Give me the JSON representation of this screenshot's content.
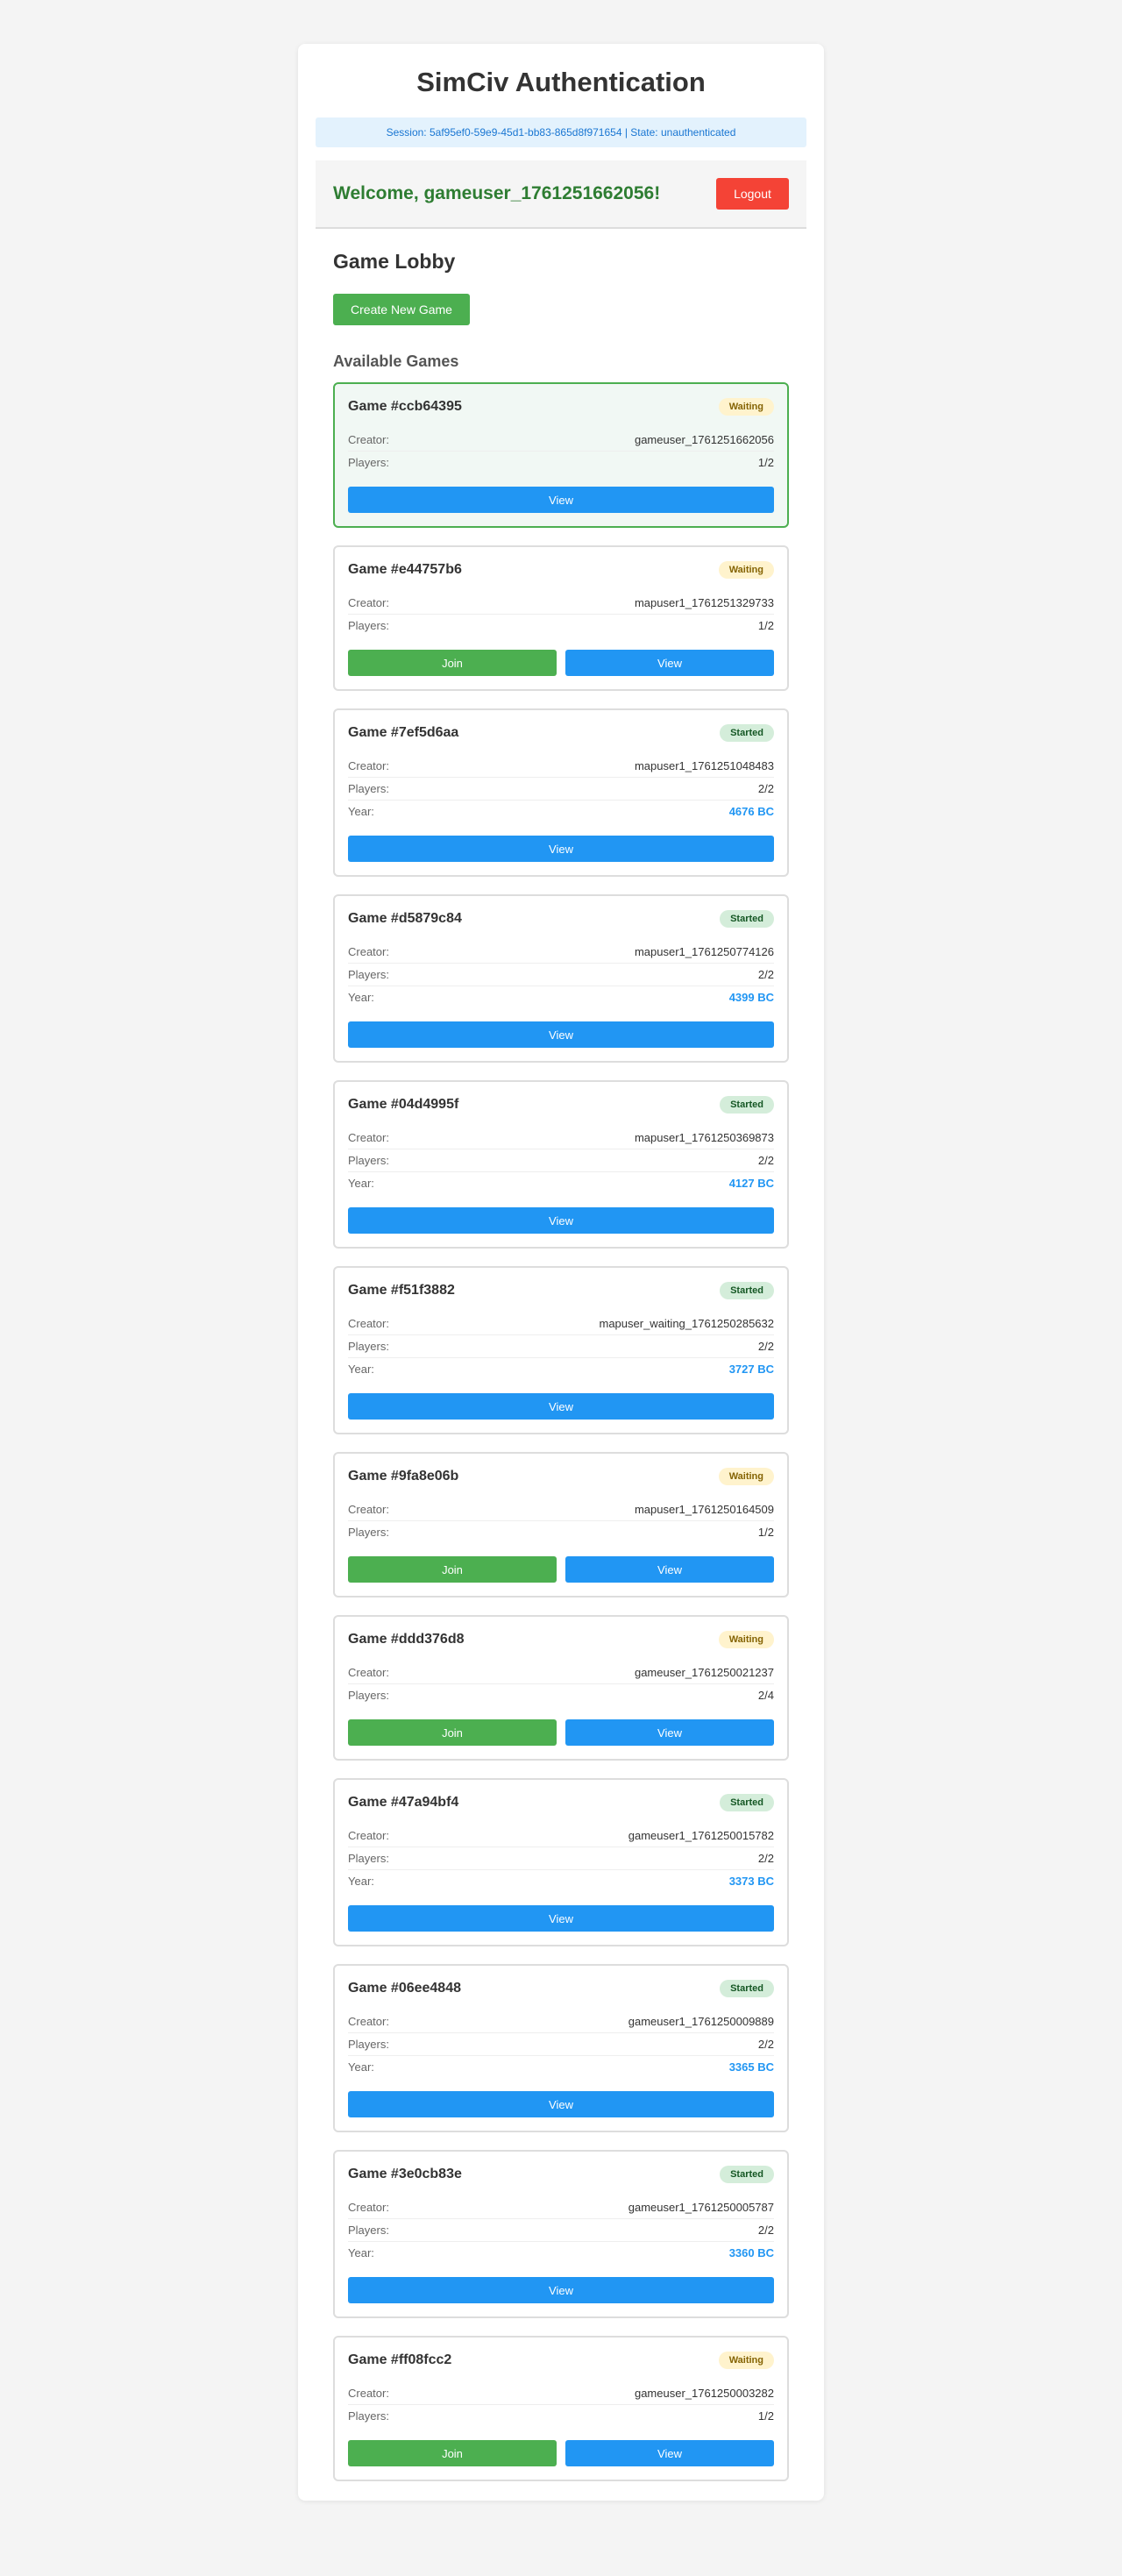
{
  "header": {
    "title": "SimCiv Authentication",
    "session": "Session: 5af95ef0-59e9-45d1-bb83-865d8f971654 | State: unauthenticated"
  },
  "user": {
    "welcome": "Welcome, gameuser_1761251662056!",
    "logout_label": "Logout"
  },
  "lobby": {
    "title": "Game Lobby",
    "create_label": "Create New Game",
    "available_title": "Available Games",
    "labels": {
      "creator": "Creator:",
      "players": "Players:",
      "year": "Year:",
      "join": "Join",
      "view": "View"
    },
    "games": [
      {
        "id": "Game #ccb64395",
        "status": "Waiting",
        "creator": "gameuser_1761251662056",
        "players": "1/2",
        "year": null,
        "mine": true
      },
      {
        "id": "Game #e44757b6",
        "status": "Waiting",
        "creator": "mapuser1_1761251329733",
        "players": "1/2",
        "year": null,
        "mine": false
      },
      {
        "id": "Game #7ef5d6aa",
        "status": "Started",
        "creator": "mapuser1_1761251048483",
        "players": "2/2",
        "year": "4676 BC",
        "mine": false
      },
      {
        "id": "Game #d5879c84",
        "status": "Started",
        "creator": "mapuser1_1761250774126",
        "players": "2/2",
        "year": "4399 BC",
        "mine": false
      },
      {
        "id": "Game #04d4995f",
        "status": "Started",
        "creator": "mapuser1_1761250369873",
        "players": "2/2",
        "year": "4127 BC",
        "mine": false
      },
      {
        "id": "Game #f51f3882",
        "status": "Started",
        "creator": "mapuser_waiting_1761250285632",
        "players": "2/2",
        "year": "3727 BC",
        "mine": false
      },
      {
        "id": "Game #9fa8e06b",
        "status": "Waiting",
        "creator": "mapuser1_1761250164509",
        "players": "1/2",
        "year": null,
        "mine": false
      },
      {
        "id": "Game #ddd376d8",
        "status": "Waiting",
        "creator": "gameuser_1761250021237",
        "players": "2/4",
        "year": null,
        "mine": false
      },
      {
        "id": "Game #47a94bf4",
        "status": "Started",
        "creator": "gameuser1_1761250015782",
        "players": "2/2",
        "year": "3373 BC",
        "mine": false
      },
      {
        "id": "Game #06ee4848",
        "status": "Started",
        "creator": "gameuser1_1761250009889",
        "players": "2/2",
        "year": "3365 BC",
        "mine": false
      },
      {
        "id": "Game #3e0cb83e",
        "status": "Started",
        "creator": "gameuser1_1761250005787",
        "players": "2/2",
        "year": "3360 BC",
        "mine": false
      },
      {
        "id": "Game #ff08fcc2",
        "status": "Waiting",
        "creator": "gameuser_1761250003282",
        "players": "1/2",
        "year": null,
        "mine": false
      }
    ]
  },
  "colors": {
    "accent_blue": "#2196f3",
    "accent_green": "#4caf50",
    "logout_red": "#f44336"
  }
}
